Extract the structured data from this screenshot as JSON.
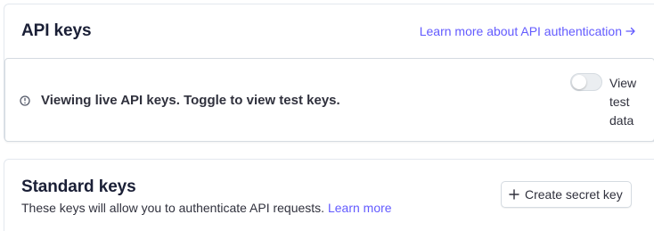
{
  "api_keys": {
    "title": "API keys",
    "learn_more_link": "Learn more about API authentication",
    "link_icon": "arrow-right-icon",
    "banner": {
      "icon": "info-icon",
      "message": "Viewing live API keys. Toggle to view test keys.",
      "toggle_label": "View test data",
      "toggle_on": false
    }
  },
  "standard_keys": {
    "title": "Standard keys",
    "description": "These keys will allow you to authenticate API requests.",
    "learn_more": "Learn more",
    "create_button": "Create secret key",
    "create_icon": "plus-icon"
  },
  "colors": {
    "accent": "#635bff",
    "text": "#1a1f36",
    "border": "#e3e8ee"
  }
}
